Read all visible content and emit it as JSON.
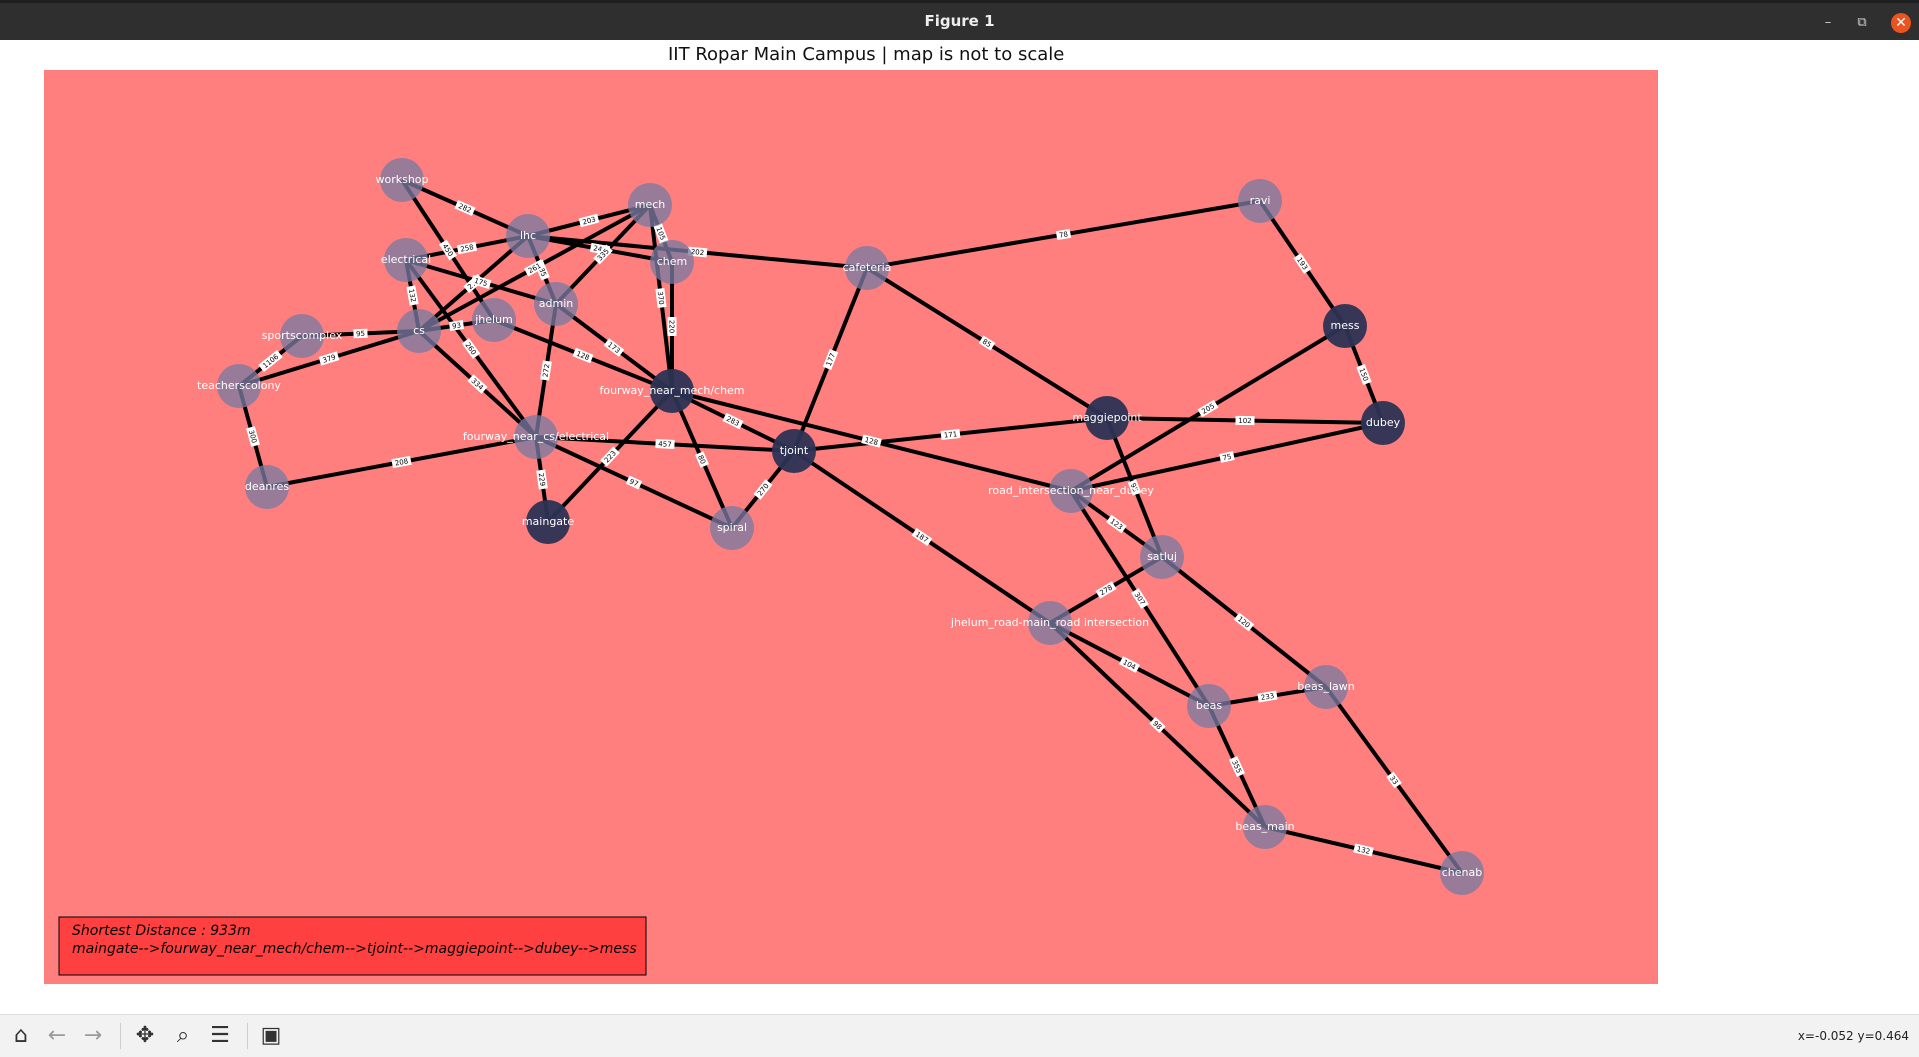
{
  "window": {
    "title": "Figure 1",
    "minimize": "–",
    "restore": "⧉",
    "close": "✕"
  },
  "figure": {
    "title": "IIT Ropar Main Campus | map is not to scale"
  },
  "colors": {
    "plot_bg": "#ff7f7f",
    "info_bg": "#ff4040",
    "edge": "#000000",
    "node_light": "#7a7aa0",
    "node_dark": "#2c3354"
  },
  "graph": {
    "nodes": [
      {
        "id": "workshop",
        "label": "workshop",
        "shade": "light"
      },
      {
        "id": "lhc",
        "label": "lhc",
        "shade": "light"
      },
      {
        "id": "mech",
        "label": "mech",
        "shade": "light"
      },
      {
        "id": "chem",
        "label": "chem",
        "shade": "light"
      },
      {
        "id": "electrical",
        "label": "electrical",
        "shade": "light"
      },
      {
        "id": "admin",
        "label": "admin",
        "shade": "light"
      },
      {
        "id": "jhelum",
        "label": "jhelum",
        "shade": "light"
      },
      {
        "id": "cs",
        "label": "cs",
        "shade": "light"
      },
      {
        "id": "sportscomplex",
        "label": "sportscomplex",
        "shade": "light"
      },
      {
        "id": "teacherscolony",
        "label": "teacherscolony",
        "shade": "light"
      },
      {
        "id": "deanres",
        "label": "deanres",
        "shade": "light"
      },
      {
        "id": "fourway_cs",
        "label": "fourway_near_cs/electrical",
        "shade": "light"
      },
      {
        "id": "maingate",
        "label": "maingate",
        "shade": "dark"
      },
      {
        "id": "fourway_mech",
        "label": "fourway_near_mech/chem",
        "shade": "dark"
      },
      {
        "id": "spiral",
        "label": "spiral",
        "shade": "light"
      },
      {
        "id": "tjoint",
        "label": "tjoint",
        "shade": "dark"
      },
      {
        "id": "cafeteria",
        "label": "cafeteria",
        "shade": "light"
      },
      {
        "id": "ravi",
        "label": "ravi",
        "shade": "light"
      },
      {
        "id": "mess",
        "label": "mess",
        "shade": "dark"
      },
      {
        "id": "dubey",
        "label": "dubey",
        "shade": "dark"
      },
      {
        "id": "maggiepoint",
        "label": "maggiepoint",
        "shade": "dark"
      },
      {
        "id": "road_int_dubey",
        "label": "road_intersection_near_dubey",
        "shade": "light"
      },
      {
        "id": "satluj",
        "label": "satluj",
        "shade": "light"
      },
      {
        "id": "jhelum_road",
        "label": "jhelum_road-main_road intersection",
        "shade": "light"
      },
      {
        "id": "beas",
        "label": "beas",
        "shade": "light"
      },
      {
        "id": "beas_lawn",
        "label": "beas_lawn",
        "shade": "light"
      },
      {
        "id": "beas_main",
        "label": "beas_main",
        "shade": "light"
      },
      {
        "id": "chenab",
        "label": "chenab",
        "shade": "light"
      }
    ],
    "edges": [
      {
        "from": "workshop",
        "to": "lhc",
        "label": "282"
      },
      {
        "from": "workshop",
        "to": "jhelum",
        "label": "450"
      },
      {
        "from": "lhc",
        "to": "mech",
        "label": "203"
      },
      {
        "from": "lhc",
        "to": "chem",
        "label": "249"
      },
      {
        "from": "lhc",
        "to": "admin",
        "label": "185"
      },
      {
        "from": "lhc",
        "to": "electrical",
        "label": "258"
      },
      {
        "from": "lhc",
        "to": "cafeteria",
        "label": "202"
      },
      {
        "from": "lhc",
        "to": "cs",
        "label": "279"
      },
      {
        "from": "mech",
        "to": "admin",
        "label": "335"
      },
      {
        "from": "mech",
        "to": "chem",
        "label": "105"
      },
      {
        "from": "mech",
        "to": "fourway_mech",
        "label": "370"
      },
      {
        "from": "mech",
        "to": "cs",
        "label": "261"
      },
      {
        "from": "chem",
        "to": "fourway_mech",
        "label": "220"
      },
      {
        "from": "electrical",
        "to": "cs",
        "label": "132"
      },
      {
        "from": "electrical",
        "to": "admin",
        "label": "175"
      },
      {
        "from": "electrical",
        "to": "fourway_cs",
        "label": "260"
      },
      {
        "from": "admin",
        "to": "fourway_mech",
        "label": "173"
      },
      {
        "from": "admin",
        "to": "fourway_cs",
        "label": "272"
      },
      {
        "from": "cs",
        "to": "jhelum",
        "label": "93"
      },
      {
        "from": "cs",
        "to": "fourway_cs",
        "label": "334"
      },
      {
        "from": "sportscomplex",
        "to": "cs",
        "label": "95"
      },
      {
        "from": "sportscomplex",
        "to": "teacherscolony",
        "label": "1106"
      },
      {
        "from": "teacherscolony",
        "to": "cs",
        "label": "379"
      },
      {
        "from": "teacherscolony",
        "to": "deanres",
        "label": "300"
      },
      {
        "from": "deanres",
        "to": "fourway_cs",
        "label": "208"
      },
      {
        "from": "jhelum",
        "to": "fourway_mech",
        "label": "128"
      },
      {
        "from": "fourway_cs",
        "to": "maingate",
        "label": "229"
      },
      {
        "from": "fourway_cs",
        "to": "tjoint",
        "label": "457"
      },
      {
        "from": "fourway_cs",
        "to": "spiral",
        "label": "97"
      },
      {
        "from": "maingate",
        "to": "fourway_mech",
        "label": "223"
      },
      {
        "from": "fourway_mech",
        "to": "tjoint",
        "label": "283"
      },
      {
        "from": "fourway_mech",
        "to": "spiral",
        "label": "80"
      },
      {
        "from": "fourway_mech",
        "to": "road_int_dubey",
        "label": "128"
      },
      {
        "from": "spiral",
        "to": "tjoint",
        "label": "270"
      },
      {
        "from": "tjoint",
        "to": "cafeteria",
        "label": "177"
      },
      {
        "from": "tjoint",
        "to": "maggiepoint",
        "label": "171"
      },
      {
        "from": "tjoint",
        "to": "jhelum_road",
        "label": "187"
      },
      {
        "from": "cafeteria",
        "to": "ravi",
        "label": "78"
      },
      {
        "from": "cafeteria",
        "to": "maggiepoint",
        "label": "85"
      },
      {
        "from": "ravi",
        "to": "mess",
        "label": "193"
      },
      {
        "from": "mess",
        "to": "dubey",
        "label": "150"
      },
      {
        "from": "mess",
        "to": "road_int_dubey",
        "label": "205"
      },
      {
        "from": "maggiepoint",
        "to": "dubey",
        "label": "102"
      },
      {
        "from": "maggiepoint",
        "to": "satluj",
        "label": "95"
      },
      {
        "from": "road_int_dubey",
        "to": "dubey",
        "label": "75"
      },
      {
        "from": "road_int_dubey",
        "to": "satluj",
        "label": "123"
      },
      {
        "from": "road_int_dubey",
        "to": "beas",
        "label": "307"
      },
      {
        "from": "satluj",
        "to": "jhelum_road",
        "label": "278"
      },
      {
        "from": "satluj",
        "to": "beas_lawn",
        "label": "120"
      },
      {
        "from": "jhelum_road",
        "to": "beas",
        "label": "104"
      },
      {
        "from": "jhelum_road",
        "to": "beas_main",
        "label": "98"
      },
      {
        "from": "beas",
        "to": "beas_lawn",
        "label": "233"
      },
      {
        "from": "beas",
        "to": "beas_main",
        "label": "355"
      },
      {
        "from": "beas_main",
        "to": "chenab",
        "label": "132"
      },
      {
        "from": "beas_lawn",
        "to": "chenab",
        "label": "33"
      }
    ]
  },
  "info": {
    "distance": "Shortest Distance : 933m",
    "path": "maingate-->fourway_near_mech/chem-->tjoint-->maggiepoint-->dubey-->mess"
  },
  "toolbar": {
    "coords": "x=-0.052 y=0.464"
  }
}
